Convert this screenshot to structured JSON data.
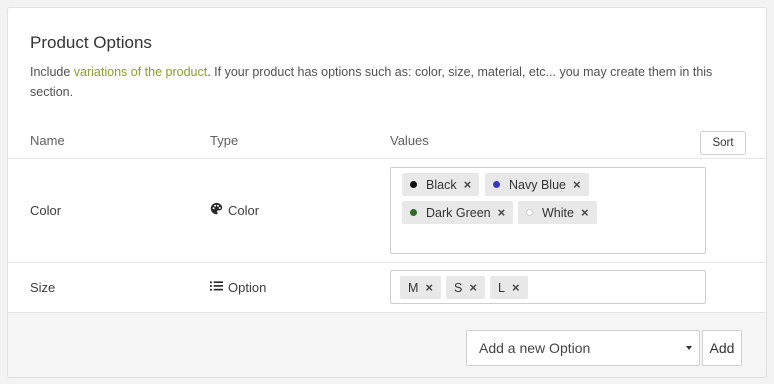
{
  "section": {
    "title": "Product Options",
    "desc_pre": "Include ",
    "desc_link": "variations of the product",
    "desc_post": ". If your product has options such as: color, size, material, etc... you may create them in this section."
  },
  "table": {
    "headers": {
      "name": "Name",
      "type": "Type",
      "values": "Values"
    },
    "sort_label": "Sort"
  },
  "rows": [
    {
      "name": "Color",
      "type": "Color",
      "type_icon": "palette-icon",
      "values": [
        {
          "label": "Black",
          "color": "#111111"
        },
        {
          "label": "Navy Blue",
          "color": "#3a35c4"
        },
        {
          "label": "Dark Green",
          "color": "#2f6b22"
        },
        {
          "label": "White",
          "color": "#ffffff"
        }
      ]
    },
    {
      "name": "Size",
      "type": "Option",
      "type_icon": "list-icon",
      "values": [
        {
          "label": "M"
        },
        {
          "label": "S"
        },
        {
          "label": "L"
        }
      ]
    }
  ],
  "footer": {
    "select_value": "Add a new Option",
    "add_label": "Add"
  },
  "remove_glyph": "×"
}
